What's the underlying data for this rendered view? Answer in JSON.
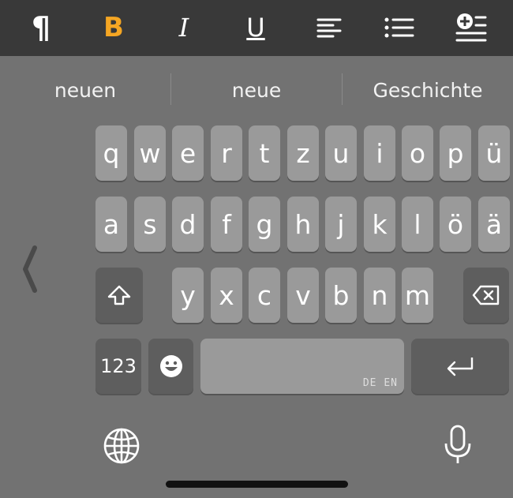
{
  "toolbar": {
    "buttons": [
      {
        "name": "paragraph-icon",
        "glyph": "¶"
      },
      {
        "name": "bold-icon",
        "glyph": "B",
        "color": "#f5a623"
      },
      {
        "name": "italic-icon",
        "glyph": "I"
      },
      {
        "name": "underline-icon",
        "glyph": "U"
      },
      {
        "name": "align-left-icon"
      },
      {
        "name": "bulleted-list-icon"
      },
      {
        "name": "insert-icon"
      }
    ]
  },
  "suggestions": [
    "neuen",
    "neue",
    "Geschichte"
  ],
  "keys": {
    "row1": [
      "q",
      "w",
      "e",
      "r",
      "t",
      "z",
      "u",
      "i",
      "o",
      "p",
      "ü"
    ],
    "row2": [
      "a",
      "s",
      "d",
      "f",
      "g",
      "h",
      "j",
      "k",
      "l",
      "ö",
      "ä"
    ],
    "row3": [
      "y",
      "x",
      "c",
      "v",
      "b",
      "n",
      "m"
    ],
    "numbers": "123",
    "space_hint": "DE EN"
  },
  "colors": {
    "accent": "#f5a623",
    "keyboard_bg": "#727272",
    "key_bg": "#9a9a9a",
    "dark_key_bg": "#5e5e5e",
    "toolbar_bg": "#393939"
  }
}
